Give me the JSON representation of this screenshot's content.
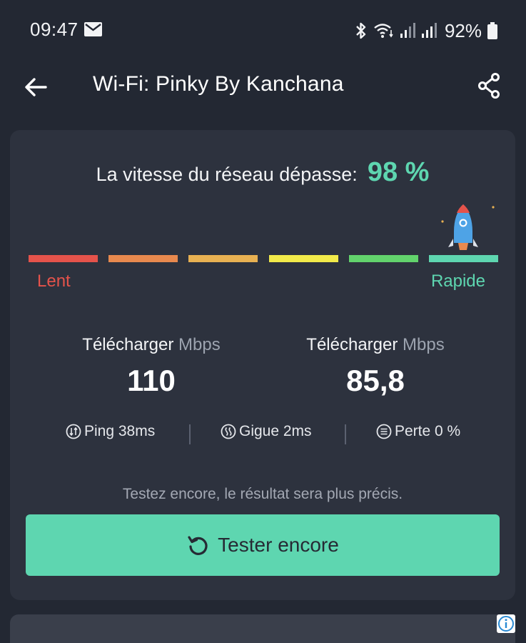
{
  "status_bar": {
    "time": "09:47",
    "battery": "92%"
  },
  "app_bar": {
    "title": "Wi-Fi: Pinky By Kanchana"
  },
  "result": {
    "headline_label": "La vitesse du réseau dépasse:",
    "headline_value": "98 %",
    "scale_colors": [
      "#e5534b",
      "#e8894e",
      "#e8b152",
      "#f2ea4a",
      "#62d36c",
      "#5ed6b0"
    ],
    "scale_slow_label": "Lent",
    "scale_fast_label": "Rapide",
    "download": {
      "label": "Télécharger",
      "unit": "Mbps",
      "value": "110"
    },
    "upload": {
      "label": "Télécharger",
      "unit": "Mbps",
      "value": "85,8"
    },
    "stats": {
      "ping": "Ping 38ms",
      "jitter": "Gigue 2ms",
      "loss": "Perte 0 %"
    },
    "hint": "Testez encore, le résultat sera plus précis.",
    "retest_label": "Tester encore"
  },
  "colors": {
    "accent": "#5ed6b0",
    "background": "#232833",
    "card": "#2d323e"
  },
  "icons": [
    "mail-icon",
    "bluetooth-icon",
    "wifi-icon",
    "signal-icon",
    "battery-icon",
    "back-arrow-icon",
    "share-icon",
    "rocket-icon",
    "ping-icon",
    "jitter-icon",
    "loss-icon",
    "refresh-icon",
    "info-icon"
  ]
}
